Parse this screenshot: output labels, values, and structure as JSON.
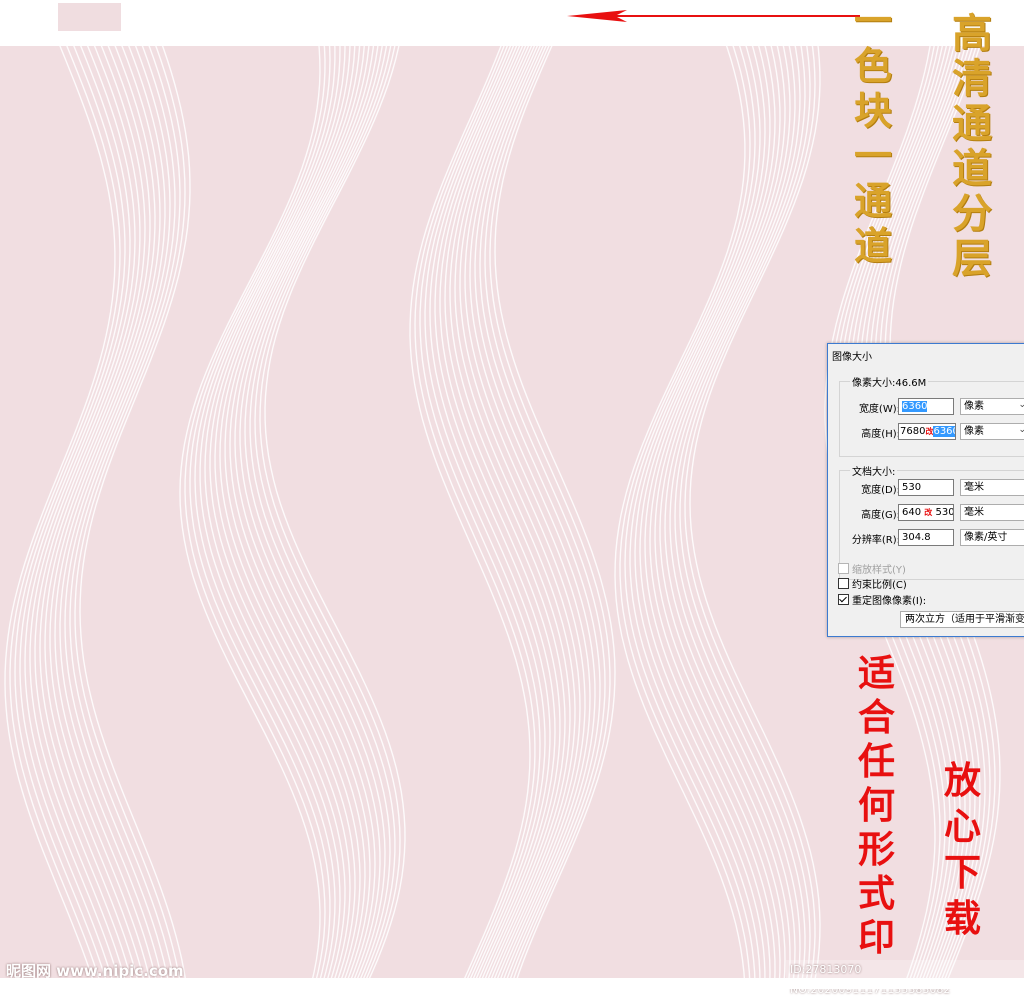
{
  "header": {
    "swatch_color": "#f0dde0",
    "arrow_color": "#e81010",
    "arrow_icon": "arrow-left-icon"
  },
  "pattern": {
    "background": "#f1dee1",
    "line_color": "#ffffff"
  },
  "side_text": {
    "left": {
      "chars": [
        "一",
        "色",
        "块",
        "一",
        "通",
        "道"
      ],
      "color": "#d9a32a"
    },
    "right": {
      "chars": [
        "高",
        "清",
        "通",
        "道",
        "分",
        "层"
      ],
      "color": "#d9a32a"
    }
  },
  "dialog": {
    "title": "图像大小",
    "pixel_group": {
      "label": "像素大小:46.6M",
      "width_label": "宽度(W):",
      "width_value": "6360",
      "width_unit": "像素",
      "height_label": "高度(H):",
      "height_old": "7680",
      "height_mark": "改",
      "height_value": "6360",
      "height_unit": "像素"
    },
    "doc_group": {
      "label": "文档大小:",
      "width_label": "宽度(D):",
      "width_value": "530",
      "width_unit": "毫米",
      "height_label": "高度(G):",
      "height_old": "640",
      "height_mark": "改",
      "height_value": "530",
      "height_unit": "毫米",
      "res_label": "分辨率(R):",
      "res_value": "304.8",
      "res_unit": "像素/英寸"
    },
    "options": {
      "scale_styles": "缩放样式(Y)",
      "constrain": "约束比例(C)",
      "resample": "重定图像像素(I):"
    },
    "method": "两次立方（适用于平滑渐变"
  },
  "bottom_text": {
    "left": {
      "chars": [
        "适",
        "合",
        "任",
        "何",
        "形",
        "式",
        "印"
      ],
      "color": "#e81010"
    },
    "right": {
      "chars": [
        "放",
        "心",
        "下",
        "载"
      ],
      "color": "#e81010"
    }
  },
  "watermarks": {
    "left": "昵图网 www.nipic.com",
    "right": "ID:27813070 NO:20200911171155383082"
  }
}
